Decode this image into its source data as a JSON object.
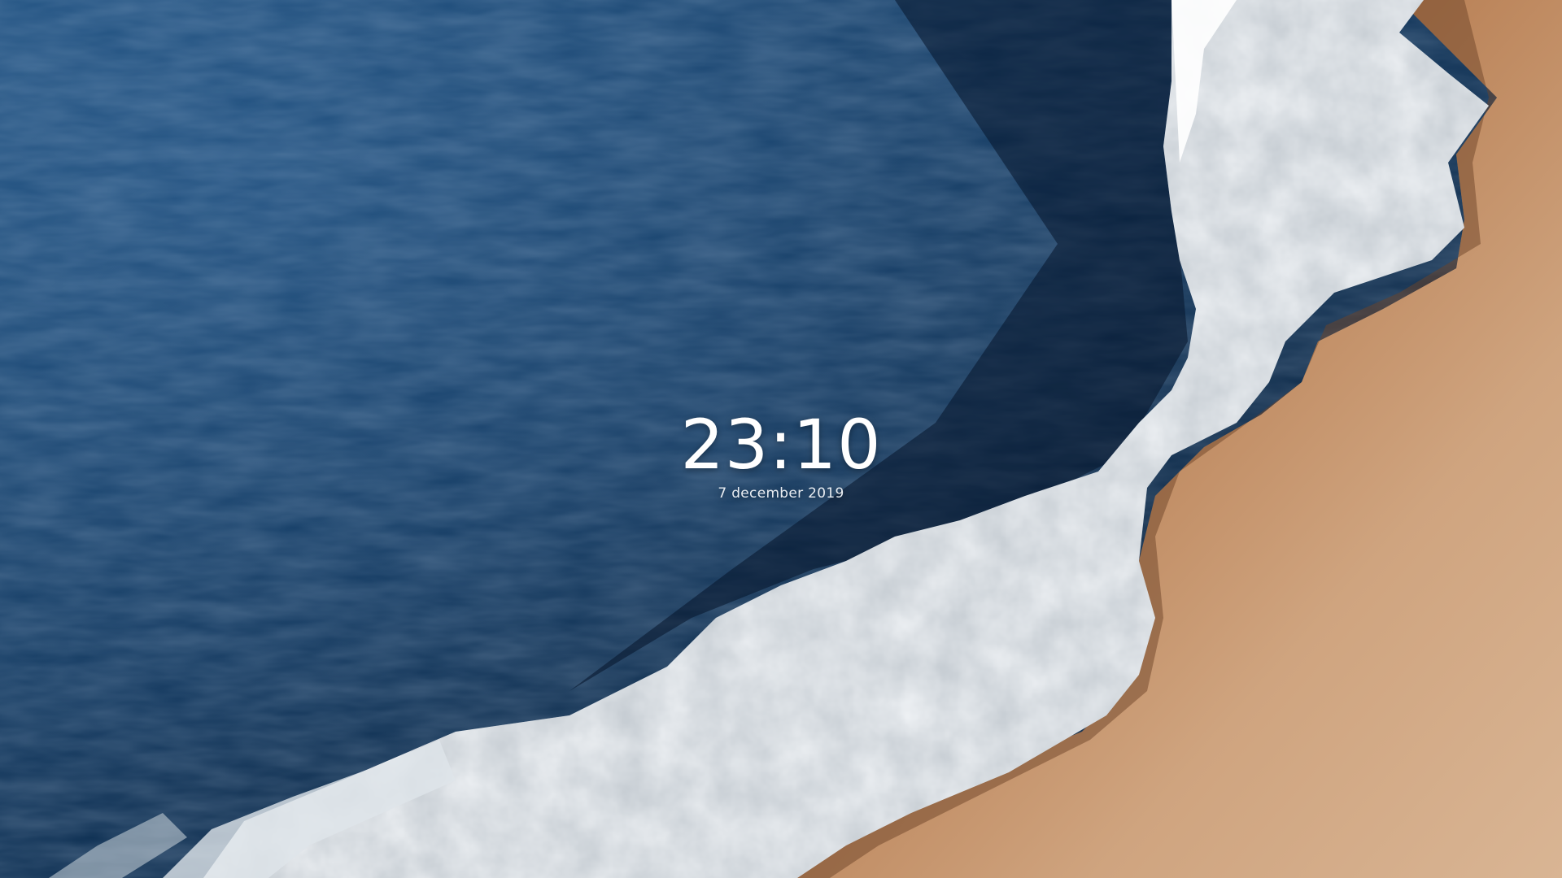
{
  "lockscreen": {
    "time": "23:10",
    "date": "7 december 2019"
  },
  "wallpaper": {
    "subject": "aerial ocean waves on sandy beach",
    "colors": {
      "deep_sea": "#0b2545",
      "sea_mid": "#123a63",
      "foam": "#f2f4f6",
      "wet_sand": "#8b5e3c",
      "dry_sand": "#d4a882"
    }
  }
}
